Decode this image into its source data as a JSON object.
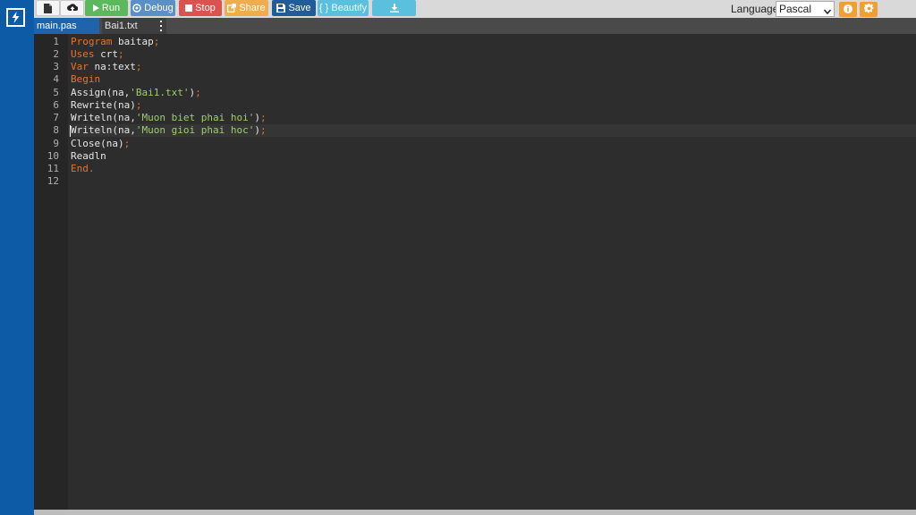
{
  "toolbar": {
    "run_label": "Run",
    "debug_label": "Debug",
    "stop_label": "Stop",
    "share_label": "Share",
    "save_label": "Save",
    "beautify_label": "{ } Beautify",
    "language_label": "Language",
    "language_value": "Pascal",
    "icons": [
      "file-icon",
      "upload-icon",
      "play-icon",
      "debug-icon",
      "stop-icon",
      "share-icon",
      "save-icon",
      "download-icon",
      "info-icon",
      "gear-icon"
    ],
    "colors": {
      "run": "#5cb85c",
      "debug": "#5a8fc7",
      "stop": "#d9534f",
      "share": "#f0ad4e",
      "save": "#1f5c99",
      "beautify": "#5bc0de",
      "download": "#5bc0de",
      "info": "#f0a030",
      "settings": "#f0a030"
    }
  },
  "tabs": [
    {
      "label": "main.pas",
      "active": true
    },
    {
      "label": "Bai1.txt",
      "active": false
    }
  ],
  "editor": {
    "line_numbers": [
      "1",
      "2",
      "3",
      "4",
      "5",
      "6",
      "7",
      "8",
      "9",
      "10",
      "11",
      "12"
    ],
    "code": [
      "Program baitap;",
      "Uses crt;",
      "Var na:text;",
      "Begin",
      "Assign(na,'Bai1.txt');",
      "Rewrite(na);",
      "Writeln(na,'Muon biet phai hoi');",
      "Writeln(na,'Muon gioi phai hoc');",
      "Close(na);",
      "Readln",
      "End.",
      ""
    ],
    "active_line": 8
  }
}
